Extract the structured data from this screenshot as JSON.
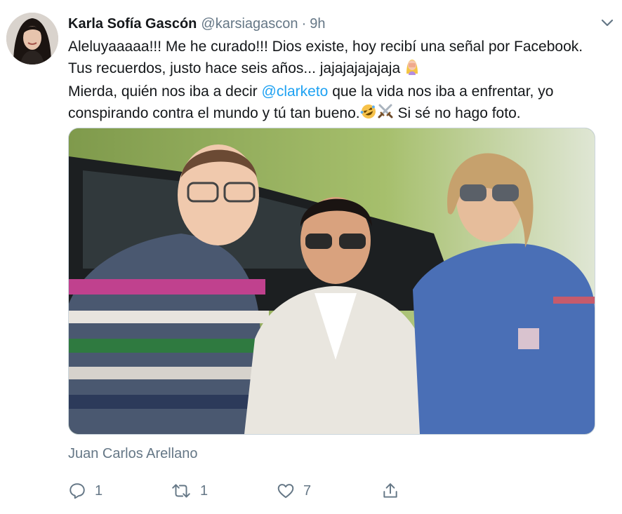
{
  "tweet": {
    "author_name": "Karla Sofía Gascón",
    "author_handle": "@karsiagascon",
    "separator": "·",
    "time": "9h",
    "text": {
      "line1": "Aleluyaaaaa!!! Me he curado!!! Dios existe, hoy recibí una señal por Facebook.",
      "line2": "Tus recuerdos, justo hace seis años... jajajajajajaja",
      "line3_before": "Mierda, quién nos iba a decir ",
      "line3_mention": "@clarketo",
      "line3_after": " que la vida nos iba a enfrentar, yo",
      "line4_before": "conspirando contra el mundo y tú tan bueno.",
      "line4_after": " Si sé no hago foto."
    },
    "media_credit": "Juan Carlos Arellano",
    "actions": {
      "reply_count": "1",
      "retweet_count": "1",
      "like_count": "7"
    }
  },
  "icons": {
    "caret": "chevron-down-icon",
    "reply": "reply-icon",
    "retweet": "retweet-icon",
    "like": "heart-icon",
    "share": "share-icon",
    "emoji_facepalm": "woman-facepalming-emoji",
    "emoji_rofl": "rolling-laughing-emoji",
    "emoji_swords": "crossed-swords-emoji"
  },
  "colors": {
    "text": "#14171a",
    "secondary": "#657786",
    "link": "#1da1f2",
    "border": "#ccd6dd"
  }
}
